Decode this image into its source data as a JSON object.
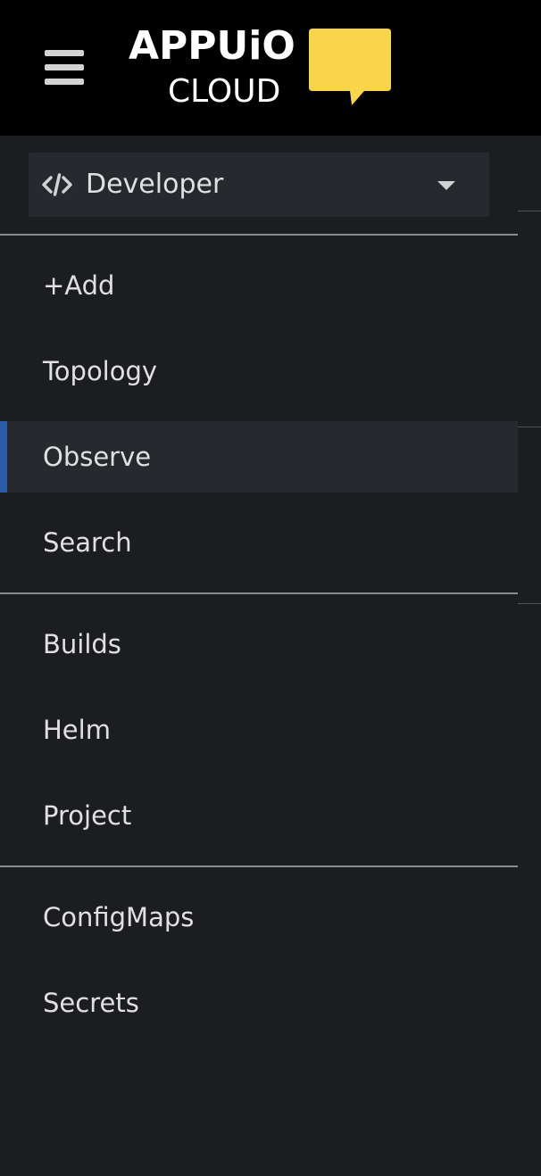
{
  "header": {
    "logo_text_top": "APPUiO",
    "logo_text_bottom": "CLOUD",
    "brand_color": "#f9d649"
  },
  "perspective": {
    "label": "Developer",
    "icon": "code-icon"
  },
  "nav": {
    "items": [
      {
        "label": "+Add"
      },
      {
        "label": "Topology"
      },
      {
        "label": "Observe",
        "active": true
      },
      {
        "label": "Search"
      },
      {
        "label": "Builds"
      },
      {
        "label": "Helm"
      },
      {
        "label": "Project"
      },
      {
        "label": "ConfigMaps"
      },
      {
        "label": "Secrets"
      }
    ]
  },
  "colors": {
    "header_bg": "#000000",
    "sidebar_bg": "#1b1d21",
    "active_bg": "#26292d",
    "active_indicator": "#2b5aa8",
    "text": "#e0e0e0"
  }
}
